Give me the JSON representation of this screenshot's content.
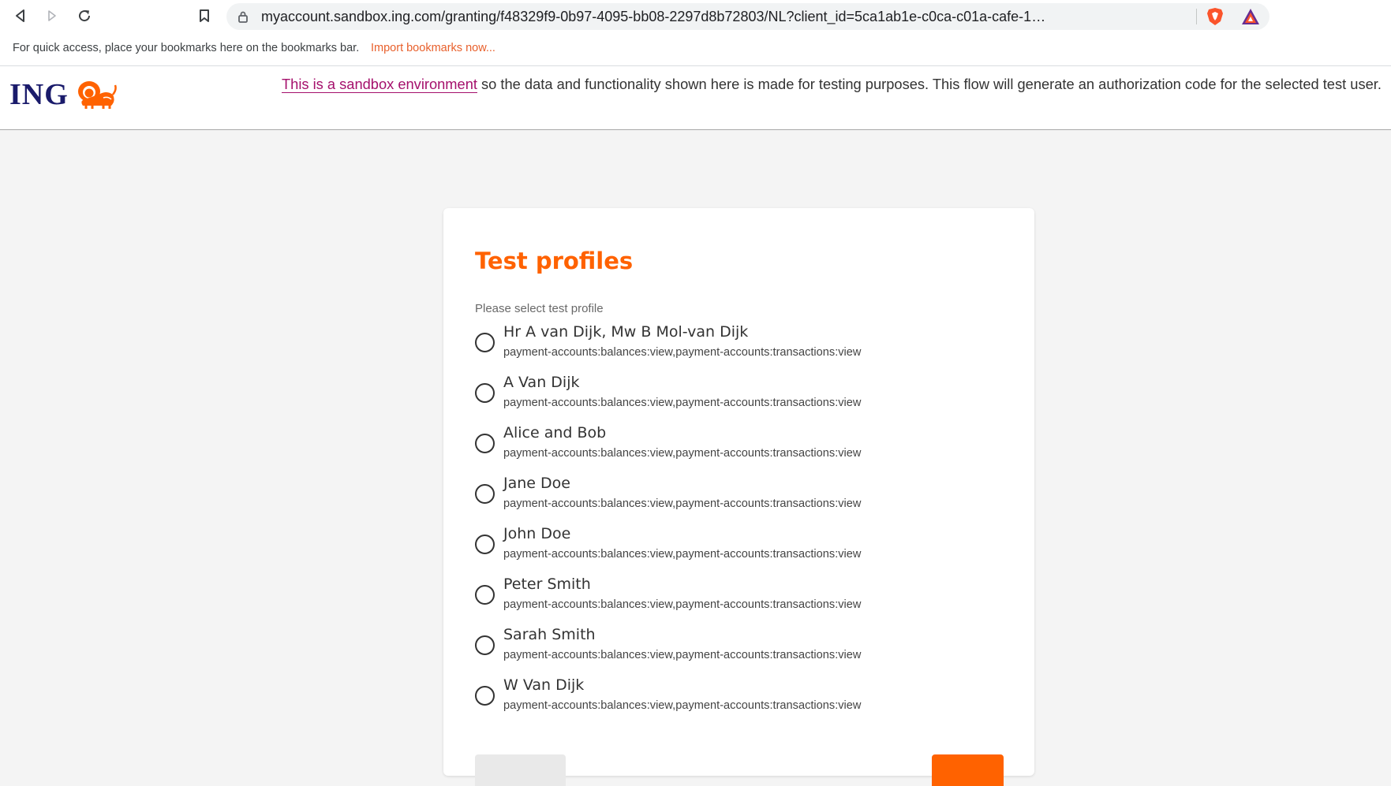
{
  "browser": {
    "url": "myaccount.sandbox.ing.com/granting/f48329f9-0b97-4095-bb08-2297d8b72803/NL?client_id=5ca1ab1e-c0ca-c01a-cafe-154deadbea75&scope=pay...",
    "bookmarks_hint": "For quick access, place your bookmarks here on the bookmarks bar.",
    "import_bookmarks_link": "Import bookmarks now...",
    "icons": [
      "back-icon",
      "forward-icon",
      "reload-icon",
      "bookmark-icon",
      "lock-icon",
      "brave-shield-icon",
      "brave-rewards-icon"
    ]
  },
  "header": {
    "logo_text": "ING",
    "notice_link": "This is a sandbox environment",
    "notice_text": " so the data and functionality shown here is made for testing purposes. This flow will generate an authorization code for the selected test user."
  },
  "card": {
    "title": "Test profiles",
    "subtitle": "Please select test profile",
    "profiles": [
      {
        "name": "Hr A van Dijk, Mw B Mol-van Dijk",
        "scope": "payment-accounts:balances:view,payment-accounts:transactions:view"
      },
      {
        "name": "A Van Dijk",
        "scope": "payment-accounts:balances:view,payment-accounts:transactions:view"
      },
      {
        "name": "Alice and Bob",
        "scope": "payment-accounts:balances:view,payment-accounts:transactions:view"
      },
      {
        "name": "Jane Doe",
        "scope": "payment-accounts:balances:view,payment-accounts:transactions:view"
      },
      {
        "name": "John Doe",
        "scope": "payment-accounts:balances:view,payment-accounts:transactions:view"
      },
      {
        "name": "Peter Smith",
        "scope": "payment-accounts:balances:view,payment-accounts:transactions:view"
      },
      {
        "name": "Sarah Smith",
        "scope": "payment-accounts:balances:view,payment-accounts:transactions:view"
      },
      {
        "name": "W Van Dijk",
        "scope": "payment-accounts:balances:view,payment-accounts:transactions:view"
      }
    ]
  },
  "colors": {
    "brand_orange": "#ff6200",
    "brand_navy": "#1a1b6b",
    "link_magenta": "#a5106c",
    "page_bg": "#f4f4f4"
  }
}
